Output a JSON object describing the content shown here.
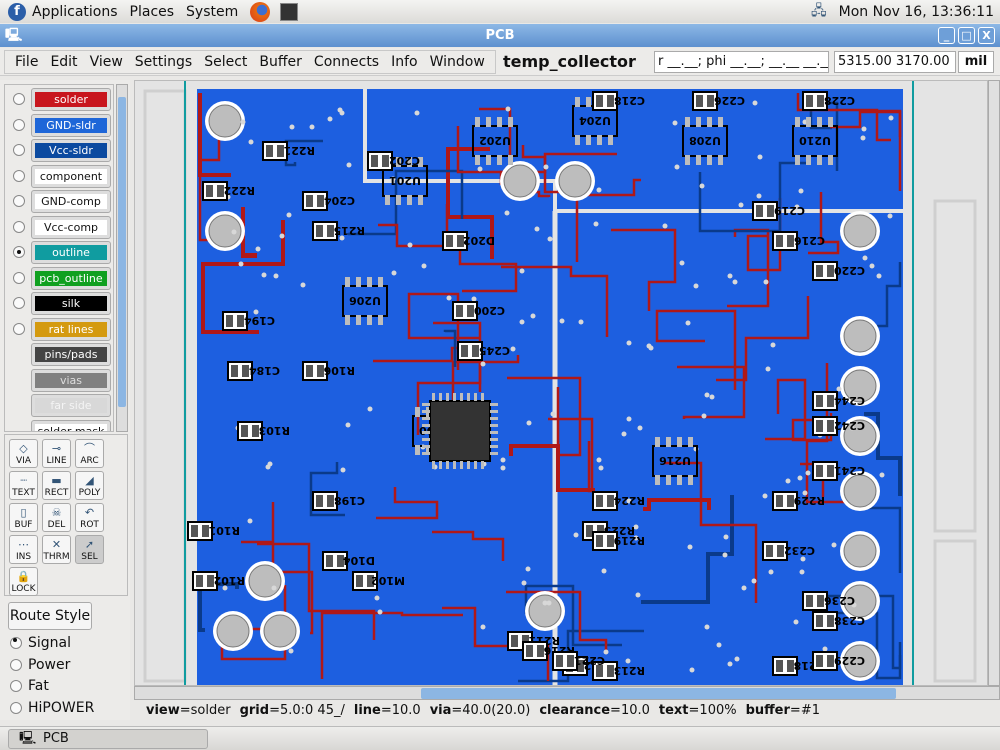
{
  "top_panel": {
    "menus": [
      "Applications",
      "Places",
      "System"
    ],
    "clock": "Mon Nov 16, 13:36:11"
  },
  "window": {
    "title": "PCB",
    "min": "_",
    "max": "□",
    "close": "X"
  },
  "menubar": {
    "items": [
      "File",
      "Edit",
      "View",
      "Settings",
      "Select",
      "Buffer",
      "Connects",
      "Info",
      "Window"
    ],
    "pcb_name": "temp_collector",
    "polar": "r __.__; phi __.__; __.__ __.__",
    "coords": "5315.00 3170.00",
    "units": "mil"
  },
  "layers": [
    {
      "label": "solder",
      "color": "#c8161e",
      "text": "#ffffff",
      "radio": true,
      "active": false
    },
    {
      "label": "GND-sldr",
      "color": "#1e66d8",
      "text": "#ffffff",
      "radio": true,
      "active": false
    },
    {
      "label": "Vcc-sldr",
      "color": "#0b4aa0",
      "text": "#ffffff",
      "radio": true,
      "active": false
    },
    {
      "label": "component",
      "color": "#ffffff",
      "text": "#111111",
      "radio": true,
      "active": false
    },
    {
      "label": "GND-comp",
      "color": "#ffffff",
      "text": "#111111",
      "radio": true,
      "active": false
    },
    {
      "label": "Vcc-comp",
      "color": "#ffffff",
      "text": "#111111",
      "radio": true,
      "active": false
    },
    {
      "label": "outline",
      "color": "#109ca0",
      "text": "#ffffff",
      "radio": true,
      "active": true
    },
    {
      "label": "pcb_outline",
      "color": "#10a020",
      "text": "#ffffff",
      "radio": true,
      "active": false
    },
    {
      "label": "silk",
      "color": "#000000",
      "text": "#ffffff",
      "radio": true,
      "active": false
    },
    {
      "label": "rat lines",
      "color": "#d49a10",
      "text": "#ffffff",
      "radio": true,
      "active": false
    },
    {
      "label": "pins/pads",
      "color": "#444444",
      "text": "#ffffff",
      "radio": false,
      "active": false
    },
    {
      "label": "vias",
      "color": "#808080",
      "text": "#dddddd",
      "radio": false,
      "active": false
    },
    {
      "label": "far side",
      "color": "#d8d8d8",
      "text": "#f4f4f4",
      "radio": false,
      "active": false
    },
    {
      "label": "solder mask",
      "color": "#ffffff",
      "text": "#111111",
      "radio": false,
      "active": false
    }
  ],
  "tools": [
    {
      "label": "VIA",
      "icon": "via-icon",
      "glyph": "◇"
    },
    {
      "label": "LINE",
      "icon": "line-icon",
      "glyph": "⊸"
    },
    {
      "label": "ARC",
      "icon": "arc-icon",
      "glyph": "⌒"
    },
    {
      "label": "TEXT",
      "icon": "text-icon",
      "glyph": "┈"
    },
    {
      "label": "RECT",
      "icon": "rect-icon",
      "glyph": "▬"
    },
    {
      "label": "POLY",
      "icon": "poly-icon",
      "glyph": "◢"
    },
    {
      "label": "BUF",
      "icon": "buffer-icon",
      "glyph": "▯"
    },
    {
      "label": "DEL",
      "icon": "delete-icon",
      "glyph": "☠"
    },
    {
      "label": "ROT",
      "icon": "rotate-icon",
      "glyph": "↶"
    },
    {
      "label": "INS",
      "icon": "insert-icon",
      "glyph": "⋯"
    },
    {
      "label": "THRM",
      "icon": "thermal-icon",
      "glyph": "✕"
    },
    {
      "label": "SEL",
      "icon": "select-icon",
      "glyph": "➚",
      "selected": true
    },
    {
      "label": "LOCK",
      "icon": "lock-icon",
      "glyph": "🔒"
    }
  ],
  "route_style": {
    "button": "Route Style",
    "options": [
      {
        "label": "Signal",
        "checked": true
      },
      {
        "label": "Power",
        "checked": false
      },
      {
        "label": "Fat",
        "checked": false
      },
      {
        "label": "HiPOWER",
        "checked": false
      }
    ]
  },
  "status": [
    {
      "k": "view",
      "v": "=solder"
    },
    {
      "k": "grid",
      "v": "=5.0:0  45_/"
    },
    {
      "k": "line",
      "v": "=10.0"
    },
    {
      "k": "via",
      "v": "=40.0(20.0)"
    },
    {
      "k": "clearance",
      "v": "=10.0"
    },
    {
      "k": "text",
      "v": "=100%"
    },
    {
      "k": "buffer",
      "v": "=#1"
    }
  ],
  "taskbar": {
    "item": "PCB"
  },
  "board": {
    "colors": {
      "ground": "#1d5fe0",
      "trace": "#b01818",
      "blue_trace": "#0a3a8a",
      "pad": "#bdbdbd",
      "outline": "#109ca0"
    },
    "refdes": [
      "R221",
      "R222",
      "C204",
      "U201",
      "C202",
      "U202",
      "C226",
      "U208",
      "C228",
      "U210",
      "U204",
      "C218",
      "C219",
      "R215",
      "D202",
      "C216",
      "C220",
      "U206",
      "C194",
      "C184",
      "R103",
      "R106",
      "C200",
      "C245",
      "U200",
      "C244",
      "C242",
      "C241",
      "C238",
      "R225",
      "R219",
      "R224",
      "U216",
      "R229",
      "D104",
      "M102",
      "R101",
      "R102",
      "C198",
      "R211",
      "R216",
      "R212",
      "R213",
      "R218",
      "C229",
      "C232",
      "C236",
      "C221"
    ]
  }
}
